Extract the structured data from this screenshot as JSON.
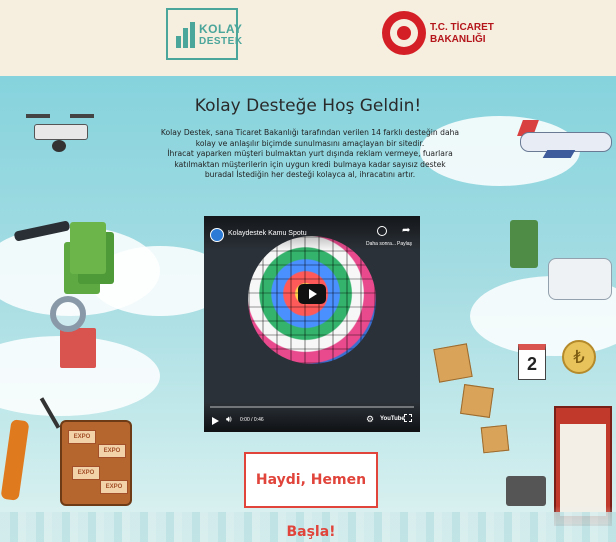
{
  "header": {
    "kolay_logo": {
      "line1": "KOLAY",
      "line2": "DESTEK"
    },
    "ministry_logo": {
      "line1": "T.C. TİCARET",
      "line2": "BAKANLIĞI"
    }
  },
  "main": {
    "title": "Kolay Desteğe Hoş Geldin!",
    "description": [
      "Kolay Destek, sana Ticaret Bakanlığı tarafından verilen 14 farklı desteğin daha kolay ve anlaşılır biçimde sunulmasını amaçlayan bir sitedir.",
      "İhracat yaparken müşteri bulmaktan yurt dışında reklam vermeye, fuarlara katılmaktan müşterilerin için uygun kredi bulmaya kadar sayısız destek buradal İstediğin her desteği kolayca al, ihracatını artır."
    ],
    "cta_label": "Haydi, Hemen Başla!"
  },
  "video": {
    "title": "Kolaydestek Kamu Spotu",
    "watch_later_label": "Daha sonra...",
    "share_label": "Paylaş",
    "time": "0:00 / 0:46",
    "brand": "YouTube",
    "progress": 0
  },
  "decor": {
    "calendar_number": "2",
    "currency_symbol": "₺",
    "sticker_text": "EXPO"
  },
  "colors": {
    "header_bg": "#f6eedf",
    "kolay_teal": "#4aa59a",
    "ministry_red": "#d41f26",
    "cta_red": "#e0443b",
    "sky": "#86d3dd"
  }
}
